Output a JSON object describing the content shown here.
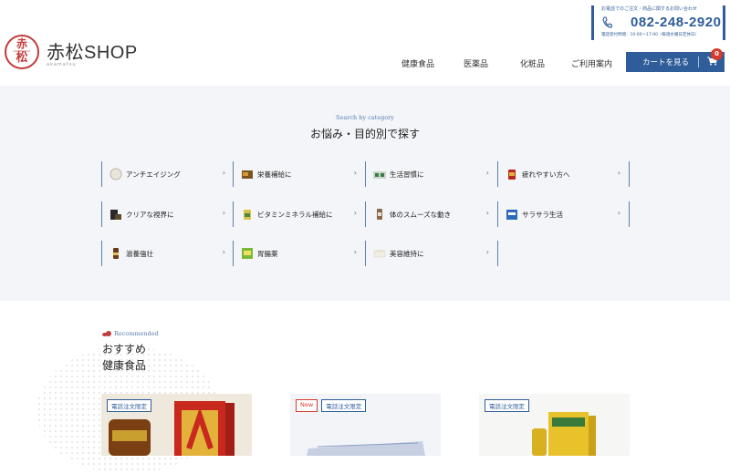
{
  "header": {
    "logo_mark_top": "赤",
    "logo_mark_bottom": "松",
    "logo_mark_ring": "AKAMATSU",
    "logo_title": "赤松SHOP",
    "logo_sub": "akamatsu",
    "tel_note": "お電話でのご注文・商品に関するお問い合わせ",
    "tel_number": "082-248-2920",
    "tel_hours": "電話受付時間：10:00〜17:00（毎週水曜日定休日）",
    "nav": [
      "健康食品",
      "医薬品",
      "化粧品",
      "ご利用案内"
    ],
    "cart_label": "カートを見る",
    "cart_count": "0"
  },
  "categories": {
    "subtitle": "Search by category",
    "title": "お悩み・目的別で探す",
    "items": [
      {
        "label": "アンチエイジング",
        "icon": "capsule-icon"
      },
      {
        "label": "栄養補給に",
        "icon": "supplement-box-icon"
      },
      {
        "label": "生活習慣に",
        "icon": "product-box-icon"
      },
      {
        "label": "疲れやすい方へ",
        "icon": "red-bottle-icon"
      },
      {
        "label": "クリアな視界に",
        "icon": "dark-box-icon"
      },
      {
        "label": "ビタミンミネラル補給に",
        "icon": "vitamin-bottle-icon"
      },
      {
        "label": "体のスムーズな動き",
        "icon": "bottle-icon"
      },
      {
        "label": "サラサラ生活",
        "icon": "blue-box-icon"
      },
      {
        "label": "滋養強壮",
        "icon": "tonic-bottle-icon"
      },
      {
        "label": "胃腸薬",
        "icon": "green-box-icon"
      },
      {
        "label": "美容維持に",
        "icon": "cream-jar-icon"
      }
    ]
  },
  "recommended": {
    "subtitle": "Recommended",
    "title_line1": "おすすめ",
    "title_line2": "健康食品",
    "cards": [
      {
        "badges": [
          "電話注文限定"
        ],
        "new": false
      },
      {
        "badges": [
          "電話注文限定"
        ],
        "new": true,
        "new_label": "New"
      },
      {
        "badges": [
          "電話注文限定"
        ],
        "new": false
      }
    ]
  },
  "colors": {
    "accent": "#2f5d9a",
    "brand_red": "#c33a3a",
    "badge_red": "#d63b2f",
    "section_bg": "#f3f5f9"
  }
}
